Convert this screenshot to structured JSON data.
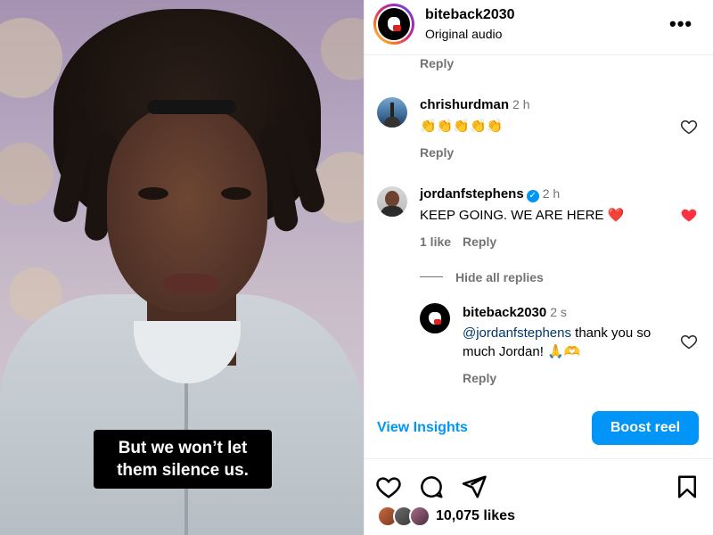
{
  "header": {
    "username": "biteback2030",
    "subtitle": "Original audio",
    "more_glyph": "•••"
  },
  "video": {
    "caption": "But we won’t let\nthem silence us."
  },
  "comments": {
    "top_reply_label": "Reply",
    "items": [
      {
        "username": "chrishurdman",
        "time": "2 h",
        "text": "👏👏👏👏👏",
        "reply_label": "Reply",
        "liked": false
      },
      {
        "username": "jordanfstephens",
        "verified": true,
        "time": "2 h",
        "text": "KEEP GOING. WE ARE HERE ❤️",
        "likes_label": "1 like",
        "reply_label": "Reply",
        "liked": true,
        "hide_replies_label": "Hide all replies",
        "replies": [
          {
            "username": "biteback2030",
            "time": "2 s",
            "mention": "@jordanfstephens",
            "text": " thank you so much Jordan! 🙏🫶",
            "reply_label": "Reply",
            "liked": false
          }
        ]
      }
    ]
  },
  "insights": {
    "view_label": "View Insights",
    "boost_label": "Boost reel"
  },
  "actions": {
    "icons": [
      "heart-icon",
      "comment-icon",
      "share-icon",
      "bookmark-icon"
    ]
  },
  "likes": {
    "count_label": "10,075 likes"
  },
  "colors": {
    "accent": "#0095f6",
    "liked_heart": "#ff3040",
    "muted": "#737373",
    "mention": "#00376b"
  }
}
